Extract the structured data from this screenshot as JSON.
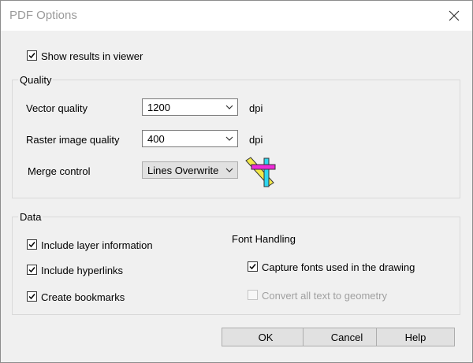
{
  "dialog": {
    "title": "PDF Options"
  },
  "show_results": {
    "label": "Show results in viewer",
    "checked": true
  },
  "quality": {
    "title": "Quality",
    "vector": {
      "label": "Vector quality",
      "value": "1200",
      "unit": "dpi"
    },
    "raster": {
      "label": "Raster image quality",
      "value": "400",
      "unit": "dpi"
    },
    "merge": {
      "label": "Merge control",
      "value": "Lines Overwrite"
    },
    "merge_icon": "lines-overwrite-icon"
  },
  "data": {
    "title": "Data",
    "include_layer": {
      "label": "Include layer information",
      "checked": true
    },
    "include_hyperlinks": {
      "label": "Include hyperlinks",
      "checked": true
    },
    "create_bookmarks": {
      "label": "Create bookmarks",
      "checked": true
    },
    "font_handling": {
      "title": "Font Handling",
      "capture_fonts": {
        "label": "Capture fonts used in the drawing",
        "checked": true
      },
      "convert_text": {
        "label": "Convert all text to geometry",
        "checked": false,
        "enabled": false
      }
    }
  },
  "buttons": {
    "ok": "OK",
    "cancel": "Cancel",
    "help": "Help"
  },
  "icons": {
    "close": "close-icon",
    "checkmark": "checkmark-icon",
    "chevron": "chevron-down-icon"
  }
}
